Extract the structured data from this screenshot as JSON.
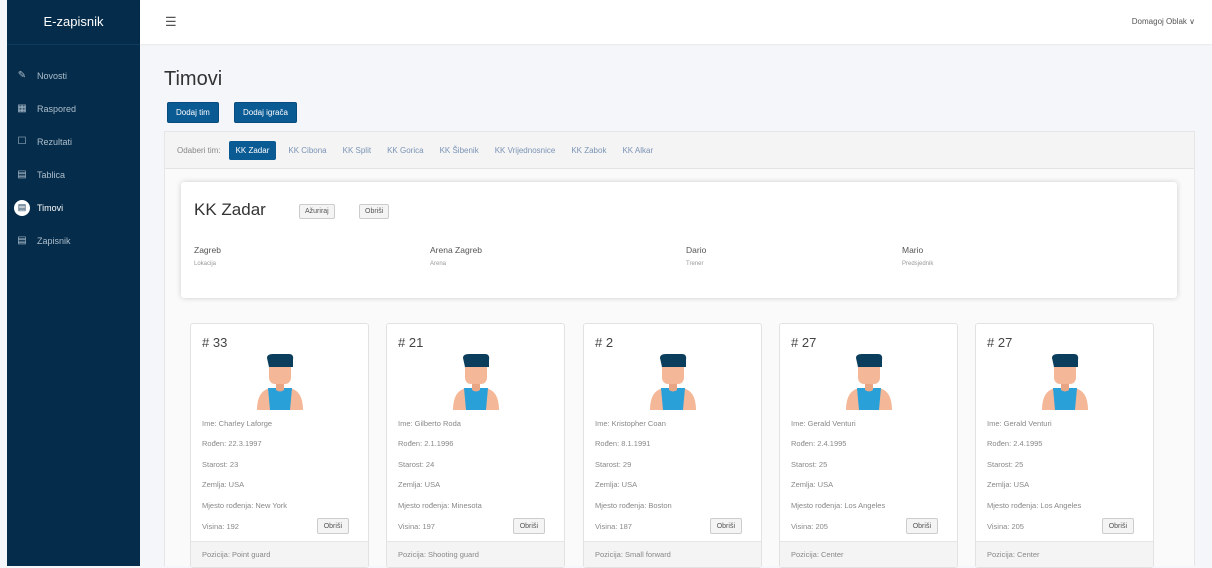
{
  "app": {
    "brand": "E-zapisnik"
  },
  "sidebar": {
    "items": [
      {
        "label": "Novosti",
        "icon": "pencil-icon"
      },
      {
        "label": "Raspored",
        "icon": "calendar-icon"
      },
      {
        "label": "Rezultati",
        "icon": "edit-icon"
      },
      {
        "label": "Tablica",
        "icon": "document-icon"
      },
      {
        "label": "Timovi",
        "icon": "document-icon",
        "active": true
      },
      {
        "label": "Zapisnik",
        "icon": "document-icon"
      }
    ]
  },
  "header": {
    "user": "Domagoj Oblak ∨",
    "menu_icon": "hamburger-icon"
  },
  "page": {
    "title": "Timovi",
    "add_team_label": "Dodaj tim",
    "add_player_label": "Dodaj igrača",
    "tabs_label": "Odaberi tim:",
    "tabs": [
      "KK Zadar",
      "KK Cibona",
      "KK Split",
      "KK Gorica",
      "KK Šibenik",
      "KK Vrijednosnice",
      "KK Zabok",
      "KK Alkar"
    ],
    "active_tab": "KK Zadar"
  },
  "team": {
    "name": "KK Zadar",
    "update_label": "Ažuriraj",
    "delete_label": "Obriši",
    "info": [
      {
        "value": "Zagreb",
        "label": "Lokacija"
      },
      {
        "value": "Arena Zagreb",
        "label": "Arena"
      },
      {
        "value": "Dario",
        "label": "Trener"
      },
      {
        "value": "Mario",
        "label": "Predsjednik"
      }
    ]
  },
  "players": [
    {
      "number": "# 33",
      "name": "Ime: Charley Laforge",
      "born": "Rođen: 22.3.1997",
      "age": "Starost: 23",
      "country": "Zemlja: USA",
      "birthplace": "Mjesto rođenja: New York",
      "height": "Visina: 192",
      "delete_label": "Obriši",
      "position": "Pozicija: Point guard"
    },
    {
      "number": "# 21",
      "name": "Ime: Gilberto Roda",
      "born": "Rođen: 2.1.1996",
      "age": "Starost: 24",
      "country": "Zemlja: USA",
      "birthplace": "Mjesto rođenja: Minesota",
      "height": "Visina: 197",
      "delete_label": "Obriši",
      "position": "Pozicija: Shooting guard"
    },
    {
      "number": "# 2",
      "name": "Ime: Kristopher Coan",
      "born": "Rođen: 8.1.1991",
      "age": "Starost: 29",
      "country": "Zemlja: USA",
      "birthplace": "Mjesto rođenja: Boston",
      "height": "Visina: 187",
      "delete_label": "Obriši",
      "position": "Pozicija: Small forward"
    },
    {
      "number": "# 27",
      "name": "Ime: Gerald Venturi",
      "born": "Rođen: 2.4.1995",
      "age": "Starost: 25",
      "country": "Zemlja: USA",
      "birthplace": "Mjesto rođenja: Los Angeles",
      "height": "Visina: 205",
      "delete_label": "Obriši",
      "position": "Pozicija: Center"
    },
    {
      "number": "# 27",
      "name": "Ime: Gerald Venturi",
      "born": "Rođen: 2.4.1995",
      "age": "Starost: 25",
      "country": "Zemlja: USA",
      "birthplace": "Mjesto rođenja: Los Angeles",
      "height": "Visina: 205",
      "delete_label": "Obriši",
      "position": "Pozicija: Center"
    }
  ],
  "colors": {
    "sidebar": "#052c4a",
    "primary": "#0a5a94",
    "tab_link": "#7b94b5"
  }
}
